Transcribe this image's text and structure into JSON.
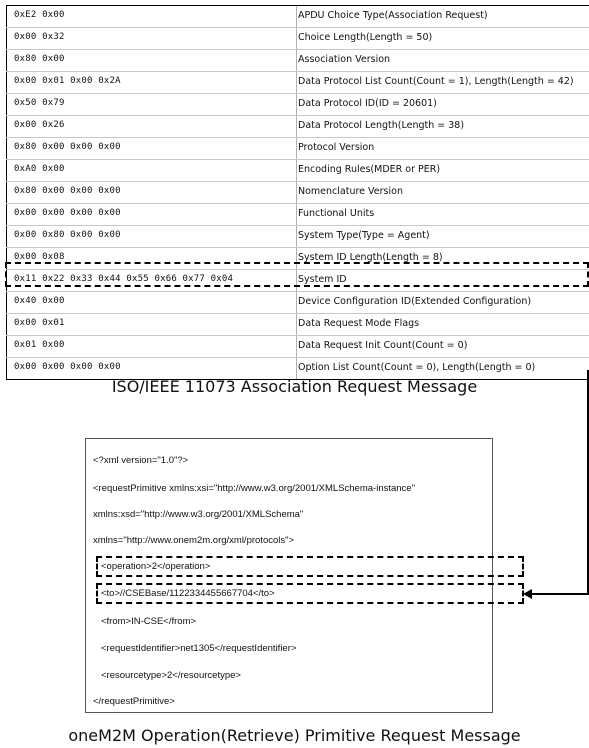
{
  "table": {
    "rows": [
      {
        "hex": "0xE2 0x00",
        "desc": "APDU Choice Type(Association Request)"
      },
      {
        "hex": "0x00 0x32",
        "desc": "Choice Length(Length = 50)"
      },
      {
        "hex": "0x80 0x00",
        "desc": "Association Version"
      },
      {
        "hex": "0x00 0x01 0x00 0x2A",
        "desc": "Data Protocol List Count(Count = 1), Length(Length = 42)"
      },
      {
        "hex": "0x50 0x79",
        "desc": "Data Protocol ID(ID = 20601)"
      },
      {
        "hex": "0x00 0x26",
        "desc": "Data Protocol Length(Length = 38)"
      },
      {
        "hex": "0x80 0x00 0x00 0x00",
        "desc": "Protocol Version"
      },
      {
        "hex": "0xA0 0x00",
        "desc": "Encoding Rules(MDER or PER)"
      },
      {
        "hex": "0x80 0x00 0x00 0x00",
        "desc": "Nomenclature Version"
      },
      {
        "hex": "0x00 0x00 0x00 0x00",
        "desc": "Functional Units"
      },
      {
        "hex": "0x00 0x80 0x00 0x00",
        "desc": "System Type(Type = Agent)"
      },
      {
        "hex": "0x00 0x08",
        "desc": "System ID Length(Length = 8)"
      },
      {
        "hex": "0x11 0x22 0x33 0x44 0x55 0x66 0x77 0x04",
        "desc": "System ID"
      },
      {
        "hex": "0x40 0x00",
        "desc": "Device Configuration ID(Extended Configuration)"
      },
      {
        "hex": "0x00 0x01",
        "desc": "Data Request Mode Flags"
      },
      {
        "hex": "0x01 0x00",
        "desc": "Data Request Init Count(Count = 0)"
      },
      {
        "hex": "0x00 0x00 0x00 0x00",
        "desc": "Option List Count(Count = 0), Length(Length = 0)"
      }
    ]
  },
  "captions": {
    "table": "ISO/IEEE 11073 Association Request Message",
    "xml": "oneM2M Operation(Retrieve) Primitive Request Message"
  },
  "xml": {
    "lines": [
      "<?xml version=\"1.0\"?>",
      "<requestPrimitive  xmlns:xsi=\"http://www.w3.org/2001/XMLSchema-instance\"",
      "xmlns:xsd=\"http://www.w3.org/2001/XMLSchema\"",
      "xmlns=\"http://www.onem2m.org/xml/protocols\">",
      "<operation>2</operation>",
      "<to>//CSEBase/1122334455667704</to>",
      "<from>IN-CSE</from>",
      "<requestIdentifier>net1305</requestIdentifier>",
      "<resourcetype>2</resourcetype>",
      "</requestPrimitive>"
    ]
  }
}
